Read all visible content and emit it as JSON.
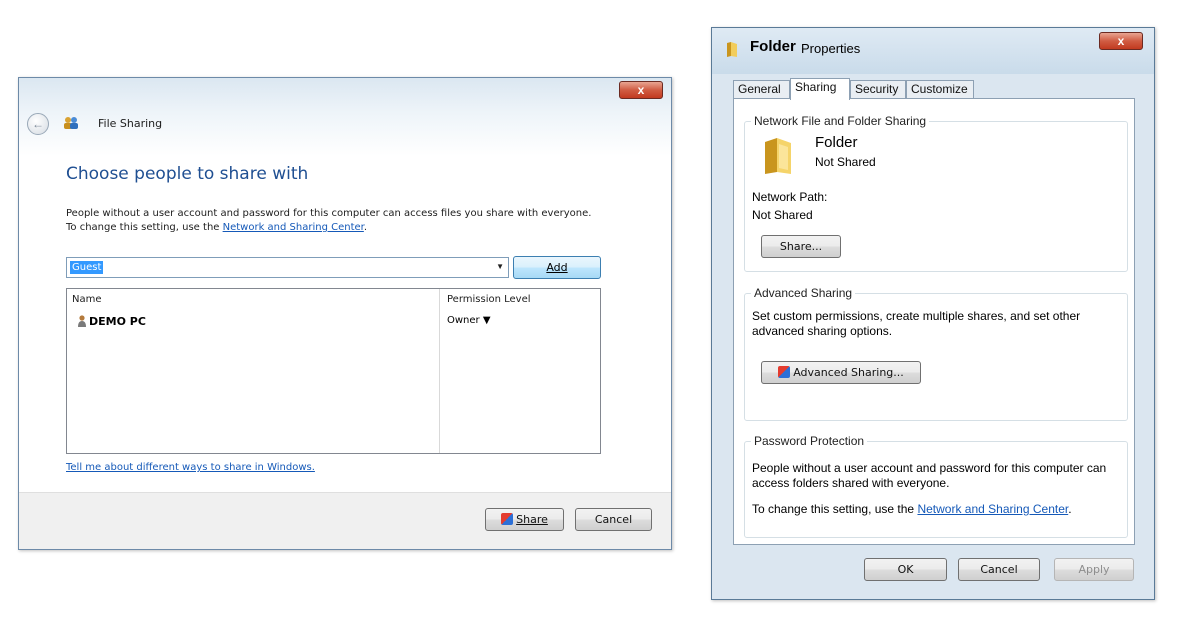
{
  "file_sharing": {
    "title": "File Sharing",
    "close_label": "x",
    "back_label": "←",
    "heading": "Choose people to share with",
    "desc_line1": "People without a user account and password for this computer can access files you share with everyone.",
    "desc_line2_prefix": "To change this setting, use the ",
    "desc_line2_link": "Network and Sharing Center",
    "desc_line2_suffix": ".",
    "combo_value": "Guest",
    "add_label": "Add",
    "table": {
      "col_name": "Name",
      "col_permission": "Permission Level",
      "rows": [
        {
          "name": "DEMO PC",
          "permission": "Owner ▼"
        }
      ]
    },
    "tell_me_link": "Tell me about different ways to share in Windows.",
    "share_label": "Share",
    "cancel_label": "Cancel"
  },
  "folder_properties": {
    "title_main": "Folder",
    "title_sub": "Properties",
    "close_label": "x",
    "tabs": [
      "General",
      "Sharing",
      "Security",
      "Customize"
    ],
    "active_tab": "Sharing",
    "network": {
      "group_label": "Network File and Folder Sharing",
      "folder_name": "Folder",
      "folder_status": "Not Shared",
      "path_label": "Network Path:",
      "path_value": "Not Shared",
      "share_button": "Share..."
    },
    "advanced": {
      "group_label": "Advanced Sharing",
      "description": "Set custom permissions, create multiple shares, and set other advanced sharing options.",
      "button": "Advanced Sharing..."
    },
    "password": {
      "group_label": "Password Protection",
      "description": "People without a user account and password for this computer can access folders shared with everyone.",
      "change_prefix": "To change this setting, use the ",
      "change_link": "Network and Sharing Center",
      "change_suffix": "."
    },
    "ok_label": "OK",
    "cancel_label": "Cancel",
    "apply_label": "Apply"
  }
}
